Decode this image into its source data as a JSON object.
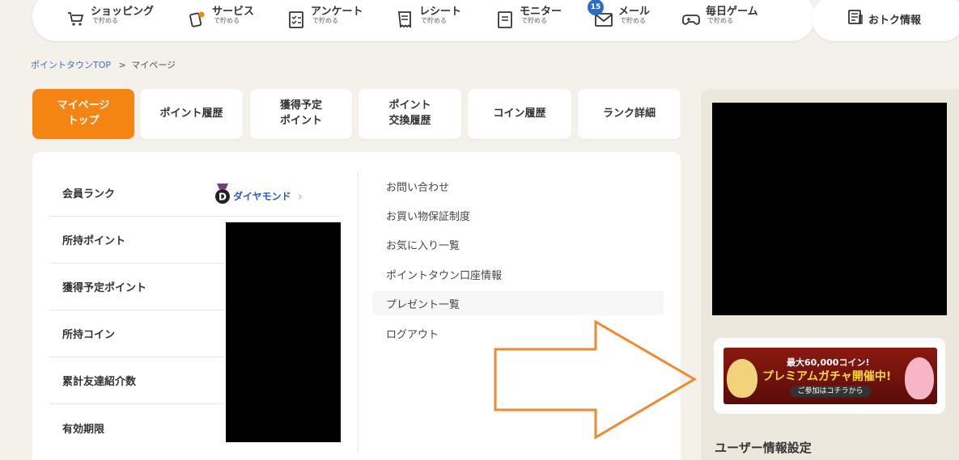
{
  "nav": [
    {
      "label": "ショッピング",
      "sub": "で貯める",
      "icon": "cart-icon"
    },
    {
      "label": "サービス",
      "sub": "で貯める",
      "icon": "service-card-icon"
    },
    {
      "label": "アンケート",
      "sub": "で貯める",
      "icon": "survey-icon"
    },
    {
      "label": "レシート",
      "sub": "で貯める",
      "icon": "receipt-icon"
    },
    {
      "label": "モニター",
      "sub": "で貯める",
      "icon": "monitor-icon"
    },
    {
      "label": "メール",
      "sub": "で貯める",
      "icon": "mail-icon",
      "badge": "15"
    },
    {
      "label": "毎日ゲーム",
      "sub": "で貯める",
      "icon": "gamepad-icon"
    }
  ],
  "otoku": {
    "label": "おトク情報",
    "icon": "news-icon"
  },
  "breadcrumb": {
    "home": "ポイントタウンTOP",
    "sep": ">",
    "current": "マイページ"
  },
  "tabs": [
    {
      "label": "マイページ\nトップ",
      "active": true
    },
    {
      "label": "ポイント履歴"
    },
    {
      "label": "獲得予定\nポイント"
    },
    {
      "label": "ポイント\n交換履歴"
    },
    {
      "label": "コイン履歴"
    },
    {
      "label": "ランク詳細"
    }
  ],
  "info_rows": [
    {
      "label": "会員ランク"
    },
    {
      "label": "所持ポイント"
    },
    {
      "label": "獲得予定ポイント"
    },
    {
      "label": "所持コイン"
    },
    {
      "label": "累計友達紹介数"
    },
    {
      "label": "有効期限"
    }
  ],
  "rank": {
    "badge_letter": "D",
    "value": "ダイヤモンド",
    "icon": "diamond-rank-icon"
  },
  "links": [
    {
      "label": "お問い合わせ"
    },
    {
      "label": "お買い物保証制度"
    },
    {
      "label": "お気に入り一覧"
    },
    {
      "label": "ポイントタウン口座情報"
    },
    {
      "label": "プレゼント一覧"
    },
    {
      "label": "ログアウト"
    }
  ],
  "banner": {
    "line1": "最大60,000コイン!",
    "line2": "プレミアムガチャ開催中!",
    "button": "ご参加はコチラから"
  },
  "sidebar": {
    "title": "ユーザー情報設定"
  },
  "colors": {
    "accent": "#f58513",
    "link": "#3a6ec4",
    "arrow": "#f08a30",
    "rank": "#2b5bc4"
  }
}
